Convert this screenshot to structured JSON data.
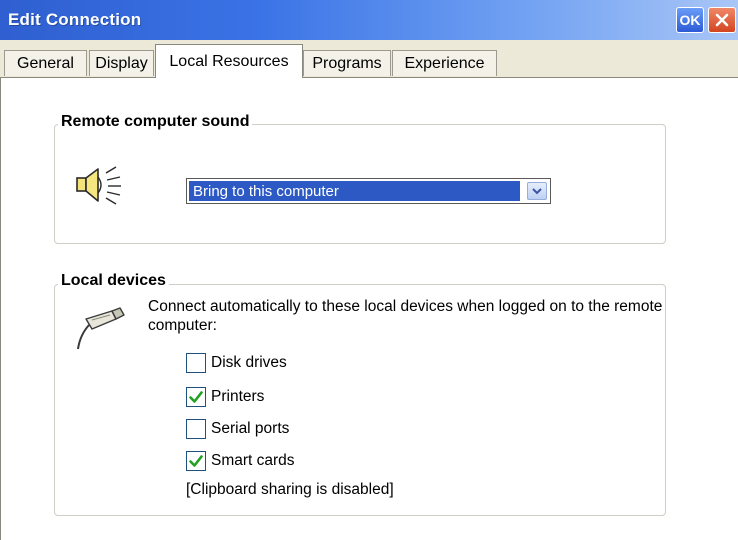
{
  "window": {
    "title": "Edit Connection",
    "ok_label": "OK",
    "close_icon": "close-icon",
    "accent_color": "#2f5fd0"
  },
  "tabs": [
    {
      "label": "General",
      "active": false
    },
    {
      "label": "Display",
      "active": false
    },
    {
      "label": "Local Resources",
      "active": true
    },
    {
      "label": "Programs",
      "active": false
    },
    {
      "label": "Experience",
      "active": false
    }
  ],
  "sound_group": {
    "legend": "Remote computer sound",
    "icon": "speaker-icon",
    "select": {
      "value": "Bring to this computer"
    }
  },
  "devices_group": {
    "legend": "Local devices",
    "icon": "cable-plug-icon",
    "description": "Connect automatically to these local devices when logged on to the remote computer:",
    "devices": [
      {
        "label": "Disk drives",
        "checked": false
      },
      {
        "label": "Printers",
        "checked": true
      },
      {
        "label": "Serial ports",
        "checked": false
      },
      {
        "label": "Smart cards",
        "checked": true
      }
    ],
    "note": "[Clipboard sharing is disabled]"
  }
}
